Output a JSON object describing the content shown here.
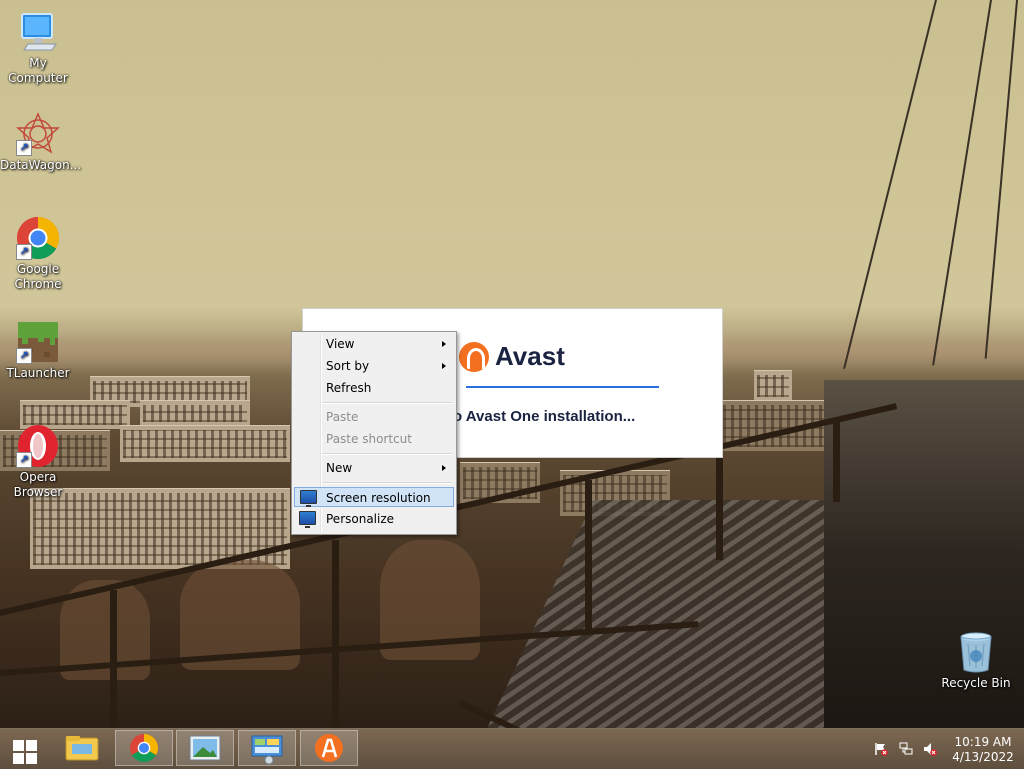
{
  "desktop": {
    "icons": [
      {
        "label": "My Computer"
      },
      {
        "label": "DataWagon..."
      },
      {
        "label": "Google Chrome"
      },
      {
        "label": "TLauncher"
      },
      {
        "label": "Opera Browser"
      },
      {
        "label": "Recycle Bin"
      }
    ]
  },
  "avast_dialog": {
    "brand": "Avast",
    "status": "o Avast One installation..."
  },
  "context_menu": {
    "items": [
      {
        "label": "View",
        "submenu": true,
        "enabled": true
      },
      {
        "label": "Sort by",
        "submenu": true,
        "enabled": true
      },
      {
        "label": "Refresh",
        "submenu": false,
        "enabled": true
      },
      {
        "label": "Paste",
        "submenu": false,
        "enabled": false
      },
      {
        "label": "Paste shortcut",
        "submenu": false,
        "enabled": false
      },
      {
        "label": "New",
        "submenu": true,
        "enabled": true
      },
      {
        "label": "Screen resolution",
        "submenu": false,
        "enabled": true,
        "highlighted": true
      },
      {
        "label": "Personalize",
        "submenu": false,
        "enabled": true
      }
    ]
  },
  "taskbar": {
    "pinned": [
      "file-explorer-icon",
      "chrome-icon",
      "photos-icon",
      "control-panel-icon",
      "avast-icon"
    ],
    "tray": [
      "action-center-flag-icon",
      "network-icon",
      "volume-muted-icon"
    ],
    "clock": {
      "time": "10:19 AM",
      "date": "4/13/2022"
    }
  },
  "colors": {
    "avast_orange": "#f37021",
    "avast_progress": "#2a6fdc",
    "menu_highlight": "#d1e4f7"
  }
}
